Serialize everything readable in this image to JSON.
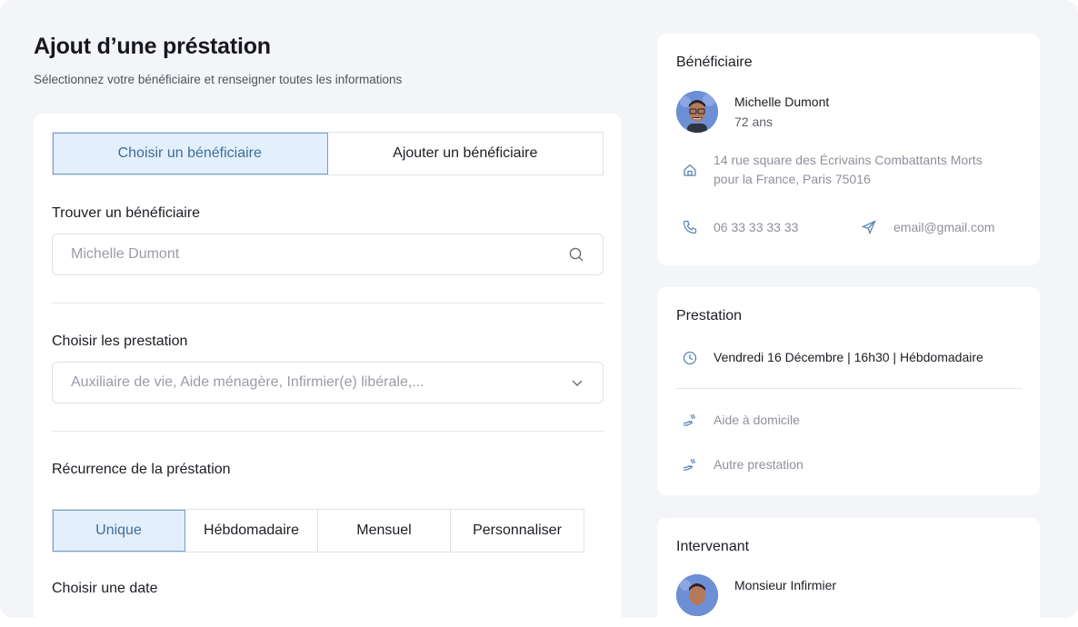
{
  "header": {
    "title": "Ajout d’une préstation",
    "subtitle": "Sélectionnez votre bénéficiaire et renseigner toutes les informations"
  },
  "form": {
    "beneficiary_tabs": [
      "Choisir un bénéficiaire",
      "Ajouter un bénéficiaire"
    ],
    "find_label": "Trouver un bénéficiaire",
    "find_placeholder": "Michelle Dumont",
    "services_label": "Choisir les prestation",
    "services_placeholder": "Auxiliaire de vie, Aide ménagère, Infirmier(e) libérale,...",
    "recurrence_label": "Récurrence de la préstation",
    "recurrence_options": [
      "Unique",
      "Hébdomadaire",
      "Mensuel",
      "Personnaliser"
    ],
    "date_label": "Choisir une date"
  },
  "beneficiary_card": {
    "title": "Bénéficiaire",
    "name": "Michelle Dumont",
    "age": "72 ans",
    "address_line1": "14 rue square des Écrivains Combattants Morts",
    "address_line2": "pour la France, Paris 75016",
    "phone": "06 33 33 33 33",
    "email": "email@gmail.com"
  },
  "prestation_card": {
    "title": "Prestation",
    "schedule": "Vendredi 16 Décembre | 16h30 | Hébdomadaire",
    "items": [
      "Aide à domicile",
      "Autre prestation"
    ]
  },
  "intervenant_card": {
    "title": "Intervenant",
    "name": "Monsieur Infirmier"
  },
  "colors": {
    "accent": "#6fa0cc",
    "accent_bg": "#e3effb",
    "background": "#f4f5f8"
  },
  "icons": [
    "search-icon",
    "chevron-down-icon",
    "home-icon",
    "phone-icon",
    "send-icon",
    "clock-icon",
    "hand-service-icon"
  ]
}
